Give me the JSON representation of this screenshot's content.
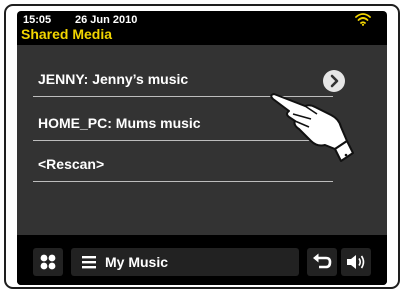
{
  "status_bar": {
    "time": "15:05",
    "date": "26 Jun 2010",
    "wifi_icon": "wifi-icon",
    "wifi_color": "#f2d500"
  },
  "header": {
    "title": "Shared Media",
    "title_color": "#f2d500"
  },
  "list": {
    "items": [
      {
        "label": "JENNY: Jenny’s music",
        "icon": "chevron-right-icon"
      },
      {
        "label": "HOME_PC: Mums music"
      },
      {
        "label": "<Rescan>"
      }
    ]
  },
  "bottom_bar": {
    "apps_icon": "apps-icon",
    "menu_icon": "menu-icon",
    "music_label": "My Music",
    "back_icon": "back-icon",
    "volume_icon": "volume-icon"
  },
  "overlay": {
    "pointer_icon": "pointing-hand-icon"
  },
  "colors": {
    "accent": "#f2d500",
    "background": "#000000",
    "list_background": "#333333"
  }
}
